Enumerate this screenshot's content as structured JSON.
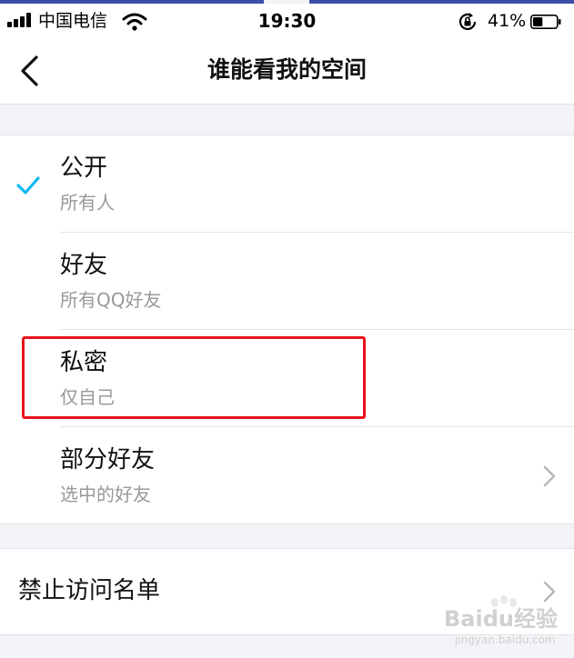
{
  "status_bar": {
    "carrier": "中国电信",
    "time": "19:30",
    "battery_percent": "41%",
    "battery_level": 0.41
  },
  "nav": {
    "title": "谁能看我的空间"
  },
  "options": [
    {
      "title": "公开",
      "subtitle": "所有人",
      "selected": true
    },
    {
      "title": "好友",
      "subtitle": "所有QQ好友",
      "selected": false
    },
    {
      "title": "私密",
      "subtitle": "仅自己",
      "selected": false
    },
    {
      "title": "部分好友",
      "subtitle": "选中的好友",
      "selected": false
    }
  ],
  "blocked_list": {
    "title": "禁止访问名单"
  },
  "watermark": {
    "text": "Baidu经验",
    "subtext": "jingyan.baidu.com"
  },
  "colors": {
    "check": "#12b7f5",
    "highlight_box": "#e8131b",
    "subtitle": "#999999",
    "background": "#f3f4f8"
  }
}
